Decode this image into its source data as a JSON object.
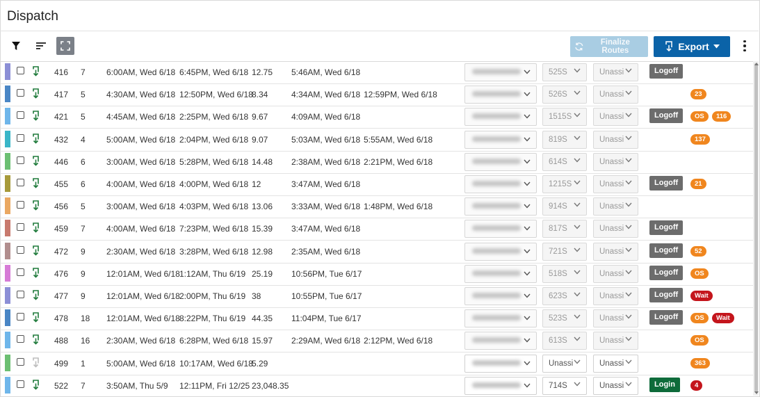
{
  "page": {
    "title": "Dispatch"
  },
  "toolbar": {
    "filter_icon": "filter-icon",
    "sort_icon": "sort-icon",
    "expand_icon": "expand-icon",
    "finalize_label": "Finalize Routes",
    "export_label": "Export",
    "more_icon": "more-vertical-icon"
  },
  "colors": {
    "export_button": "#0b63a8",
    "finalize_button": "#a9cde3",
    "logoff_button": "#6c6c6c",
    "login_button": "#0e6b3a",
    "badge_orange": "#f0861e",
    "badge_red": "#c4151c"
  },
  "rows": [
    {
      "color": "#8c8fd6",
      "route": "416",
      "stops": "7",
      "start": "6:00AM, Wed 6/18",
      "end": "6:45PM, Wed 6/18",
      "hours": "12.75",
      "actual_start": "5:46AM, Wed 6/18",
      "actual_end": "",
      "driver_live": false,
      "vehicle": "525S",
      "vehicle_live": false,
      "assign": "Unassi",
      "assign_live": false,
      "action": "Logoff",
      "badges": []
    },
    {
      "color": "#4a86c5",
      "route": "417",
      "stops": "5",
      "start": "4:30AM, Wed 6/18",
      "end": "12:50PM, Wed 6/18",
      "hours": "8.34",
      "actual_start": "4:34AM, Wed 6/18",
      "actual_end": "12:59PM, Wed 6/18",
      "driver_live": false,
      "vehicle": "526S",
      "vehicle_live": false,
      "assign": "Unassi",
      "assign_live": false,
      "action": "",
      "badges": [
        {
          "text": "23",
          "tone": "orange"
        }
      ]
    },
    {
      "color": "#6fb6ea",
      "route": "421",
      "stops": "5",
      "start": "4:45AM, Wed 6/18",
      "end": "2:25PM, Wed 6/18",
      "hours": "9.67",
      "actual_start": "4:09AM, Wed 6/18",
      "actual_end": "",
      "driver_live": false,
      "vehicle": "1515S",
      "vehicle_live": false,
      "assign": "Unassi",
      "assign_live": false,
      "action": "Logoff",
      "badges": [
        {
          "text": "OS",
          "tone": "orange"
        },
        {
          "text": "116",
          "tone": "orange"
        }
      ]
    },
    {
      "color": "#3ab6c8",
      "route": "432",
      "stops": "4",
      "start": "5:00AM, Wed 6/18",
      "end": "2:04PM, Wed 6/18",
      "hours": "9.07",
      "actual_start": "5:03AM, Wed 6/18",
      "actual_end": "5:55AM, Wed 6/18",
      "driver_live": false,
      "vehicle": "819S",
      "vehicle_live": false,
      "assign": "Unassi",
      "assign_live": false,
      "action": "",
      "badges": [
        {
          "text": "137",
          "tone": "orange"
        }
      ]
    },
    {
      "color": "#6cbf72",
      "route": "446",
      "stops": "6",
      "start": "3:00AM, Wed 6/18",
      "end": "5:28PM, Wed 6/18",
      "hours": "14.48",
      "actual_start": "2:38AM, Wed 6/18",
      "actual_end": "2:21PM, Wed 6/18",
      "driver_live": false,
      "vehicle": "614S",
      "vehicle_live": false,
      "assign": "Unassi",
      "assign_live": false,
      "action": "",
      "badges": []
    },
    {
      "color": "#a79a3a",
      "route": "455",
      "stops": "6",
      "start": "4:00AM, Wed 6/18",
      "end": "4:00PM, Wed 6/18",
      "hours": "12",
      "actual_start": "3:47AM, Wed 6/18",
      "actual_end": "",
      "driver_live": false,
      "vehicle": "1215S",
      "vehicle_live": false,
      "assign": "Unassi",
      "assign_live": false,
      "action": "Logoff",
      "badges": [
        {
          "text": "21",
          "tone": "orange"
        }
      ]
    },
    {
      "color": "#eaa862",
      "route": "456",
      "stops": "5",
      "start": "3:00AM, Wed 6/18",
      "end": "4:03PM, Wed 6/18",
      "hours": "13.06",
      "actual_start": "3:33AM, Wed 6/18",
      "actual_end": "1:48PM, Wed 6/18",
      "driver_live": false,
      "vehicle": "914S",
      "vehicle_live": false,
      "assign": "Unassi",
      "assign_live": false,
      "action": "",
      "badges": []
    },
    {
      "color": "#c87a6e",
      "route": "459",
      "stops": "7",
      "start": "4:00AM, Wed 6/18",
      "end": "7:23PM, Wed 6/18",
      "hours": "15.39",
      "actual_start": "3:47AM, Wed 6/18",
      "actual_end": "",
      "driver_live": false,
      "vehicle": "817S",
      "vehicle_live": false,
      "assign": "Unassi",
      "assign_live": false,
      "action": "Logoff",
      "badges": []
    },
    {
      "color": "#b18e8e",
      "route": "472",
      "stops": "9",
      "start": "2:30AM, Wed 6/18",
      "end": "3:28PM, Wed 6/18",
      "hours": "12.98",
      "actual_start": "2:35AM, Wed 6/18",
      "actual_end": "",
      "driver_live": false,
      "vehicle": "721S",
      "vehicle_live": false,
      "assign": "Unassi",
      "assign_live": false,
      "action": "Logoff",
      "badges": [
        {
          "text": "52",
          "tone": "orange"
        }
      ]
    },
    {
      "color": "#d67bd6",
      "route": "476",
      "stops": "9",
      "start": "12:01AM, Wed 6/18",
      "end": "1:12AM, Thu 6/19",
      "hours": "25.19",
      "actual_start": "10:56PM, Tue 6/17",
      "actual_end": "",
      "driver_live": false,
      "vehicle": "518S",
      "vehicle_live": false,
      "assign": "Unassi",
      "assign_live": false,
      "action": "Logoff",
      "badges": [
        {
          "text": "OS",
          "tone": "orange"
        }
      ]
    },
    {
      "color": "#8c8fd6",
      "route": "477",
      "stops": "9",
      "start": "12:01AM, Wed 6/18",
      "end": "2:00PM, Thu 6/19",
      "hours": "38",
      "actual_start": "10:55PM, Tue 6/17",
      "actual_end": "",
      "driver_live": false,
      "vehicle": "623S",
      "vehicle_live": false,
      "assign": "Unassi",
      "assign_live": false,
      "action": "Logoff",
      "badges": [
        {
          "text": "Wait",
          "tone": "red"
        }
      ]
    },
    {
      "color": "#4a86c5",
      "route": "478",
      "stops": "18",
      "start": "12:01AM, Wed 6/18",
      "end": "8:22PM, Thu 6/19",
      "hours": "44.35",
      "actual_start": "11:04PM, Tue 6/17",
      "actual_end": "",
      "driver_live": false,
      "vehicle": "523S",
      "vehicle_live": false,
      "assign": "Unassi",
      "assign_live": false,
      "action": "Logoff",
      "badges": [
        {
          "text": "OS",
          "tone": "orange"
        },
        {
          "text": "Wait",
          "tone": "red"
        }
      ]
    },
    {
      "color": "#6fb6ea",
      "route": "488",
      "stops": "16",
      "start": "2:30AM, Wed 6/18",
      "end": "6:28PM, Wed 6/18",
      "hours": "15.97",
      "actual_start": "2:29AM, Wed 6/18",
      "actual_end": "2:12PM, Wed 6/18",
      "driver_live": false,
      "vehicle": "613S",
      "vehicle_live": false,
      "assign": "Unassi",
      "assign_live": false,
      "action": "",
      "badges": [
        {
          "text": "OS",
          "tone": "orange"
        }
      ]
    },
    {
      "color": "#6cbf72",
      "route": "499",
      "stops": "1",
      "start": "5:00AM, Wed 6/18",
      "end": "10:17AM, Wed 6/18",
      "hours": "5.29",
      "actual_start": "",
      "actual_end": "",
      "driver_live": true,
      "vehicle": "Unassi",
      "vehicle_live": true,
      "assign": "Unassi",
      "assign_live": true,
      "action": "",
      "badges": [
        {
          "text": "363",
          "tone": "orange"
        }
      ],
      "dl_disabled": true
    },
    {
      "color": "#6fb6ea",
      "route": "522",
      "stops": "7",
      "start": "3:50AM, Thu 5/9",
      "end": "12:11PM, Fri 12/25",
      "hours": "23,048.35",
      "actual_start": "",
      "actual_end": "",
      "driver_live": true,
      "vehicle": "714S",
      "vehicle_live": true,
      "assign": "Unassi",
      "assign_live": true,
      "action": "Login",
      "badges": [
        {
          "text": "4",
          "tone": "red"
        }
      ]
    }
  ]
}
